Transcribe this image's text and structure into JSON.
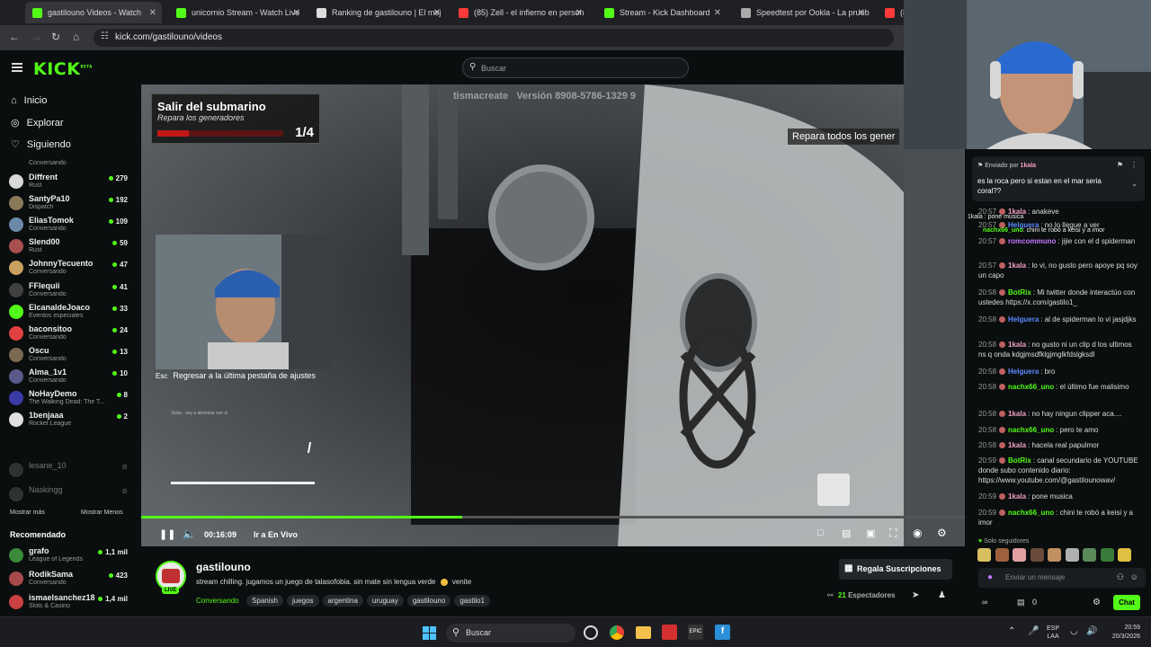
{
  "browser": {
    "tabs": [
      {
        "label": "gastilouno Videos - Watch",
        "color": "#53fc18",
        "active": true
      },
      {
        "label": "unicornio Stream - Watch Live",
        "color": "#53fc18"
      },
      {
        "label": "Ranking de gastilouno | El mej",
        "color": "#dddddd"
      },
      {
        "label": "(85) Zell - el infierno en person",
        "color": "#ff3b3b"
      },
      {
        "label": "Stream - Kick Dashboard",
        "color": "#53fc18"
      },
      {
        "label": "Speedtest por Ookla - La prueb",
        "color": "#aaaaaa"
      },
      {
        "label": "(8",
        "color": "#ff3b3b"
      }
    ],
    "url": "kick.com/gastilouno/videos"
  },
  "header": {
    "logo": "KICK",
    "logo_sup": "BETA",
    "search_placeholder": "Buscar"
  },
  "sidebar": {
    "nav": [
      {
        "label": "Inicio",
        "icon": "home-icon"
      },
      {
        "label": "Explorar",
        "icon": "compass-icon"
      },
      {
        "label": "Siguiendo",
        "icon": "heart-icon"
      }
    ],
    "top_partial": "Conversando",
    "following": [
      {
        "name": "Diffrent",
        "sub": "Rust",
        "viewers": "279",
        "color": "#d9d9d9"
      },
      {
        "name": "SantyPa10",
        "sub": "Dispatch",
        "viewers": "192",
        "color": "#8a7a5a"
      },
      {
        "name": "EliasTomok",
        "sub": "Conversando",
        "viewers": "109",
        "color": "#6a8aa8"
      },
      {
        "name": "Slend00",
        "sub": "Rust",
        "viewers": "59",
        "color": "#a85050"
      },
      {
        "name": "JohnnyTecuento",
        "sub": "Conversando",
        "viewers": "47",
        "color": "#c8a060"
      },
      {
        "name": "FFlequii",
        "sub": "Conversando",
        "viewers": "41",
        "color": "#404040"
      },
      {
        "name": "ElcanaldeJoaco",
        "sub": "Eventos especiales",
        "viewers": "33",
        "color": "#53fc18"
      },
      {
        "name": "baconsitoo",
        "sub": "Conversando",
        "viewers": "24",
        "color": "#e04040"
      },
      {
        "name": "Oscu",
        "sub": "Conversando",
        "viewers": "13",
        "color": "#7a6a50"
      },
      {
        "name": "Alma_1v1",
        "sub": "Conversando",
        "viewers": "10",
        "color": "#5a5a8a"
      },
      {
        "name": "NoHayDemo",
        "sub": "The Walking Dead: The T...",
        "viewers": "8",
        "color": "#3a3aa8"
      },
      {
        "name": "1benjaaa",
        "sub": "Rocket League",
        "viewers": "2",
        "color": "#e0e0e0"
      }
    ],
    "offline": [
      {
        "name": "lesane_10",
        "color": "#555555"
      },
      {
        "name": "Naskingg",
        "color": "#555555"
      }
    ],
    "show_more": "Mostrar más",
    "show_less": "Mostrar Menos",
    "recommended_title": "Recomendado",
    "recommended": [
      {
        "name": "grafo",
        "sub": "League of Legends",
        "viewers": "1,1 mil",
        "color": "#3a8a3a"
      },
      {
        "name": "RodikSama",
        "sub": "Conversando",
        "viewers": "423",
        "color": "#a84a4a"
      },
      {
        "name": "ismaelsanchez18",
        "sub": "Slots & Casino",
        "viewers": "1,4 mil",
        "color": "#c84040"
      }
    ]
  },
  "video": {
    "objective_title": "Salir del submarino",
    "objective_sub": "Repara los generadores",
    "objective_count": "1/4",
    "watermark": "tismacreate   Versión 8908-5786-1329 9",
    "hint": "Repara todos los gener",
    "esc_key": "Esc",
    "esc_text": "Regresar a la última pestaña de ajustes",
    "cam_caption": "1kala : soy a abonizar con el",
    "progress_fraction": 0.39,
    "time": "00:16:09",
    "live_label": "Ir a En Vivo"
  },
  "stream": {
    "channel": "gastilouno",
    "live_badge": "LIVE",
    "title": "stream chilling. jugamos un juego de talasofobia. sin mate sin lengua verde",
    "category": "Conversando",
    "tags": [
      "Spanish",
      "juegos",
      "argentina",
      "uruguay",
      "gastilouno",
      "gastilo1"
    ],
    "subs_button": "Regala Suscripciones",
    "viewers": "21",
    "viewers_label": "Espectadores"
  },
  "chat": {
    "pinned_by": "Enviado por",
    "pinned_user": "1kala",
    "pinned_text": "es la roca pero si estan en el mar seria coral??",
    "overlay_line1": "1kala : pone musica",
    "overlay_line2_user": "nachx66_uno",
    "overlay_line2_text": ": chini te robó a keisi y a imor",
    "messages": [
      {
        "time": "20:57",
        "user": "1kala",
        "color": "#f0a0c0",
        "text": ": anakeve"
      },
      {
        "time": "20:57",
        "user": "Helguera",
        "color": "#5a8aff",
        "text": ": no lo llegue a ver"
      },
      {
        "time": "20:57",
        "user": "romcommuno",
        "color": "#c07aff",
        "text": ": jijie con el d spiderman"
      },
      {
        "time": "20:57",
        "user": "1kala",
        "color": "#f0a0c0",
        "text": ": lo vi, no    gusto pero apoye pq soy un capo"
      },
      {
        "time": "20:58",
        "user": "BotRix",
        "color": "#53fc18",
        "text": ": Mi twitter donde interactúo con ustedes https://x.com/gastilo1_"
      },
      {
        "time": "20:58",
        "user": "Helguera",
        "color": "#5a8aff",
        "text": ": al de spiderman lo vi jasjdjks"
      },
      {
        "time": "20:58",
        "user": "1kala",
        "color": "#f0a0c0",
        "text": ": no    gusto ni un clip d los ultimos ns q onda kdgjmsdfklgjmglkfdslgksdl"
      },
      {
        "time": "20:58",
        "user": "Helguera",
        "color": "#5a8aff",
        "text": ": bro"
      },
      {
        "time": "20:58",
        "user": "nachx66_uno",
        "color": "#53fc18",
        "text": ": el último fue malisimo"
      },
      {
        "time": "20:58",
        "user": "1kala",
        "color": "#f0a0c0",
        "text": ": no hay ningun clipper aca...."
      },
      {
        "time": "20:58",
        "user": "nachx66_uno",
        "color": "#53fc18",
        "text": ": pero te amo"
      },
      {
        "time": "20:58",
        "user": "1kala",
        "color": "#f0a0c0",
        "text": ": hacela real papulmor"
      },
      {
        "time": "20:59",
        "user": "BotRix",
        "color": "#53fc18",
        "text": ": canal secundario de YOUTUBE donde subo contenido diario: https://www.youtube.com/@gastilounowav/"
      },
      {
        "time": "20:59",
        "user": "1kala",
        "color": "#f0a0c0",
        "text": ": pone musica"
      },
      {
        "time": "20:59",
        "user": "nachx66_uno",
        "color": "#53fc18",
        "text": ": chini te robó a keisi y a imor"
      }
    ],
    "followers_only": "Solo seguidores",
    "input_placeholder": "Enviar un mensaje",
    "points": "0",
    "send_label": "Chat"
  },
  "taskbar": {
    "search": "Buscar",
    "lang": "ESP",
    "lang2": "LAA",
    "time": "20:59",
    "date": "20/3/2026"
  }
}
